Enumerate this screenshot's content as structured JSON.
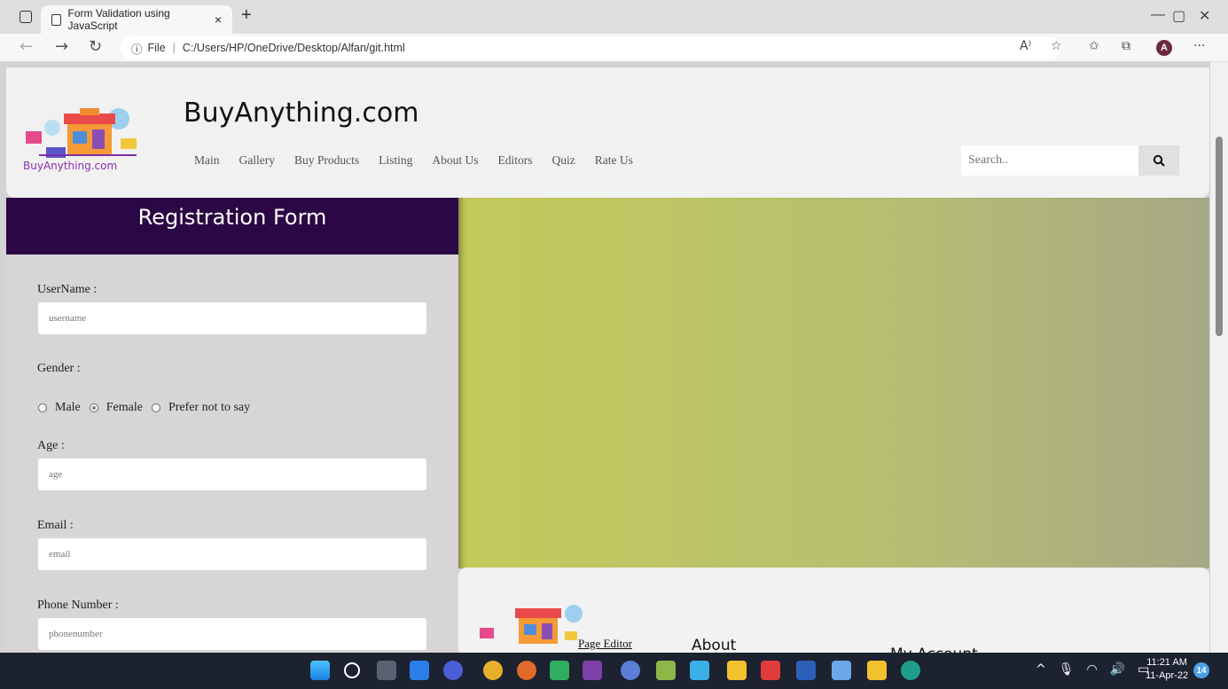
{
  "browser": {
    "tab_title": "Form Validation using JavaScript",
    "tab_close": "×",
    "new_tab": "+",
    "url_prefix": "File",
    "url_separator": "|",
    "url": "C:/Users/HP/OneDrive/Desktop/Alfan/git.html",
    "controls": {
      "minimize": "—",
      "maximize": "▢",
      "close": "✕"
    },
    "nav": {
      "back": "←",
      "forward": "→",
      "reload": "↻"
    },
    "avatar": "A",
    "icons": [
      "read-aloud-icon",
      "favorite-add-icon",
      "favorites-icon",
      "collections-icon",
      "more-icon"
    ],
    "read_aloud": "A⁾",
    "more": "···"
  },
  "header": {
    "brand": "BuyAnything.com",
    "logo_text": "BuyAnything.com",
    "menu": [
      "Main",
      "Gallery",
      "Buy Products",
      "Listing",
      "About Us",
      "Editors",
      "Quiz",
      "Rate Us"
    ],
    "search_placeholder": "Search.."
  },
  "form": {
    "title": "Registration Form",
    "username_label": "UserName :",
    "username_placeholder": "username",
    "gender_label": "Gender :",
    "gender_options": [
      {
        "label": "Male",
        "selected": false
      },
      {
        "label": "Female",
        "selected": true
      },
      {
        "label": "Prefer not to say",
        "selected": false
      }
    ],
    "age_label": "Age :",
    "age_placeholder": "age",
    "email_label": "Email :",
    "email_placeholder": "email",
    "phone_label": "Phone Number :",
    "phone_placeholder": "phonenumber"
  },
  "footer": {
    "page_editor": "Page Editor",
    "about": "About",
    "my_account": "My Account"
  },
  "taskbar": {
    "time": "11:21 AM",
    "date": "11-Apr-22",
    "notifications": "14",
    "tray": [
      "^",
      "🎤",
      "wifi",
      "🔊",
      "battery"
    ]
  },
  "colors": {
    "form_header": "#2c0745",
    "hero_left": "#c2cb5a",
    "hero_right": "#a6a985"
  }
}
